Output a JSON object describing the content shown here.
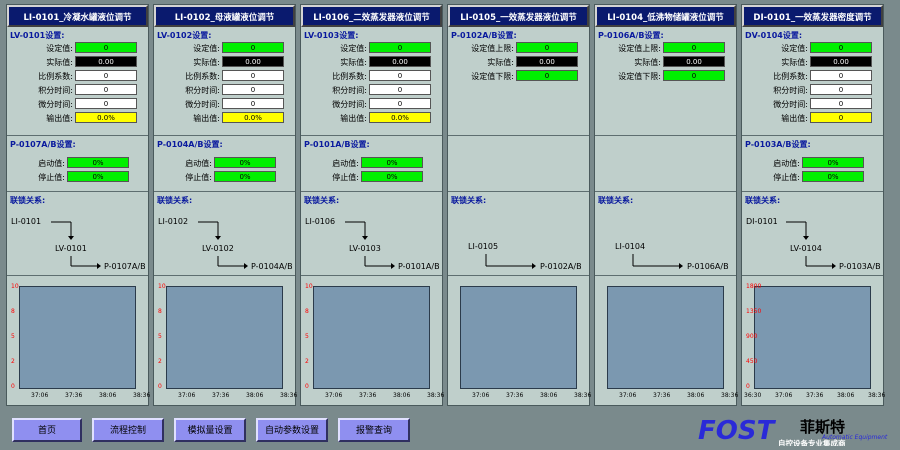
{
  "panels": [
    {
      "title": "LI-0101_冷凝水罐液位调节",
      "settings_title": "LV-0101设置:",
      "settings": [
        {
          "label": "设定值:",
          "value": "0",
          "style": "green"
        },
        {
          "label": "实际值:",
          "value": "0.00",
          "style": "black"
        },
        {
          "label": "比例系数:",
          "value": "0",
          "style": "white"
        },
        {
          "label": "积分时间:",
          "value": "0",
          "style": "white"
        },
        {
          "label": "微分时间:",
          "value": "0",
          "style": "white"
        },
        {
          "label": "输出值:",
          "value": "0.0%",
          "style": "yellow"
        }
      ],
      "pump_title": "P-0107A/B设置:",
      "pump": [
        {
          "label": "启动值:",
          "value": "0%",
          "style": "green"
        },
        {
          "label": "停止值:",
          "value": "0%",
          "style": "green"
        }
      ],
      "chain_title": "联锁关系:",
      "chain": {
        "source": "LI-0101",
        "valve": "LV-0101",
        "target": "P-0107A/B"
      },
      "y_ticks": [
        "10",
        "8",
        "5",
        "2",
        "0"
      ],
      "x_ticks": [
        "37:06",
        "37:36",
        "38:06",
        "38:36"
      ]
    },
    {
      "title": "LI-0102_母液罐液位调节",
      "settings_title": "LV-0102设置:",
      "settings": [
        {
          "label": "设定值:",
          "value": "0",
          "style": "green"
        },
        {
          "label": "实际值:",
          "value": "0.00",
          "style": "black"
        },
        {
          "label": "比例系数:",
          "value": "0",
          "style": "white"
        },
        {
          "label": "积分时间:",
          "value": "0",
          "style": "white"
        },
        {
          "label": "微分时间:",
          "value": "0",
          "style": "white"
        },
        {
          "label": "输出值:",
          "value": "0.0%",
          "style": "yellow"
        }
      ],
      "pump_title": "P-0104A/B设置:",
      "pump": [
        {
          "label": "启动值:",
          "value": "0%",
          "style": "green"
        },
        {
          "label": "停止值:",
          "value": "0%",
          "style": "green"
        }
      ],
      "chain_title": "联锁关系:",
      "chain": {
        "source": "LI-0102",
        "valve": "LV-0102",
        "target": "P-0104A/B"
      },
      "y_ticks": [
        "10",
        "8",
        "5",
        "2",
        "0"
      ],
      "x_ticks": [
        "37:06",
        "37:36",
        "38:06",
        "38:36"
      ]
    },
    {
      "title": "LI-0106_二效蒸发器液位调节",
      "settings_title": "LV-0103设置:",
      "settings": [
        {
          "label": "设定值:",
          "value": "0",
          "style": "green"
        },
        {
          "label": "实际值:",
          "value": "0.00",
          "style": "black"
        },
        {
          "label": "比例系数:",
          "value": "0",
          "style": "white"
        },
        {
          "label": "积分时间:",
          "value": "0",
          "style": "white"
        },
        {
          "label": "微分时间:",
          "value": "0",
          "style": "white"
        },
        {
          "label": "输出值:",
          "value": "0.0%",
          "style": "yellow"
        }
      ],
      "pump_title": "P-0101A/B设置:",
      "pump": [
        {
          "label": "启动值:",
          "value": "0%",
          "style": "green"
        },
        {
          "label": "停止值:",
          "value": "0%",
          "style": "green"
        }
      ],
      "chain_title": "联锁关系:",
      "chain": {
        "source": "LI-0106",
        "valve": "LV-0103",
        "target": "P-0101A/B"
      },
      "y_ticks": [
        "10",
        "8",
        "5",
        "2",
        "0"
      ],
      "x_ticks": [
        "37:06",
        "37:36",
        "38:06",
        "38:36"
      ]
    },
    {
      "title": "LI-0105_一效蒸发器液位调节",
      "settings_title": "P-0102A/B设置:",
      "settings": [
        {
          "label": "设定值上限:",
          "value": "0",
          "style": "green"
        },
        {
          "label": "实际值:",
          "value": "0.00",
          "style": "black"
        },
        {
          "label": "设定值下限:",
          "value": "0",
          "style": "green"
        }
      ],
      "pump_title": "",
      "pump": [],
      "chain_title": "联锁关系:",
      "chain": {
        "source": "LI-0105",
        "valve": "",
        "target": "P-0102A/B"
      },
      "y_ticks": [],
      "x_ticks": [
        "37:06",
        "37:36",
        "38:06",
        "38:36"
      ]
    },
    {
      "title": "LI-0104_低沸物储罐液位调节",
      "settings_title": "P-0106A/B设置:",
      "settings": [
        {
          "label": "设定值上限:",
          "value": "0",
          "style": "green"
        },
        {
          "label": "实际值:",
          "value": "0.00",
          "style": "black"
        },
        {
          "label": "设定值下限:",
          "value": "0",
          "style": "green"
        }
      ],
      "pump_title": "",
      "pump": [],
      "chain_title": "联锁关系:",
      "chain": {
        "source": "LI-0104",
        "valve": "",
        "target": "P-0106A/B"
      },
      "y_ticks": [],
      "x_ticks": [
        "37:06",
        "37:36",
        "38:06",
        "38:36"
      ]
    },
    {
      "title": "DI-0101_一效蒸发器密度调节",
      "settings_title": "DV-0104设置:",
      "settings": [
        {
          "label": "设定值:",
          "value": "0",
          "style": "green"
        },
        {
          "label": "实际值:",
          "value": "0.00",
          "style": "black"
        },
        {
          "label": "比例系数:",
          "value": "0",
          "style": "white"
        },
        {
          "label": "积分时间:",
          "value": "0",
          "style": "white"
        },
        {
          "label": "微分时间:",
          "value": "0",
          "style": "white"
        },
        {
          "label": "输出值:",
          "value": "0",
          "style": "yellow"
        }
      ],
      "pump_title": "P-0103A/B设置:",
      "pump": [
        {
          "label": "启动值:",
          "value": "0%",
          "style": "green"
        },
        {
          "label": "停止值:",
          "value": "0%",
          "style": "green"
        }
      ],
      "chain_title": "联锁关系:",
      "chain": {
        "source": "DI-0101",
        "valve": "LV-0104",
        "target": "P-0103A/B"
      },
      "y_ticks": [
        "1800",
        "1350",
        "900",
        "450",
        "0"
      ],
      "x_ticks": [
        "36:30",
        "37:06",
        "37:36",
        "38:06",
        "38:36"
      ]
    }
  ],
  "nav_buttons": [
    "首页",
    "流程控制",
    "模拟量设置",
    "自动参数设置",
    "报警查询"
  ],
  "logo": {
    "brand": "FOST",
    "cn_name": "菲斯特",
    "en_sub": "Automatic Equipment",
    "slogan": "自控设备专业集成商"
  },
  "colors": {
    "title_bar": "#0a1a6e",
    "panel_bg": "#bfcfcb",
    "plot_bg": "#7b98b0",
    "button": "#8f8ff0",
    "green": "#00f000",
    "yellow": "#ffff00"
  }
}
